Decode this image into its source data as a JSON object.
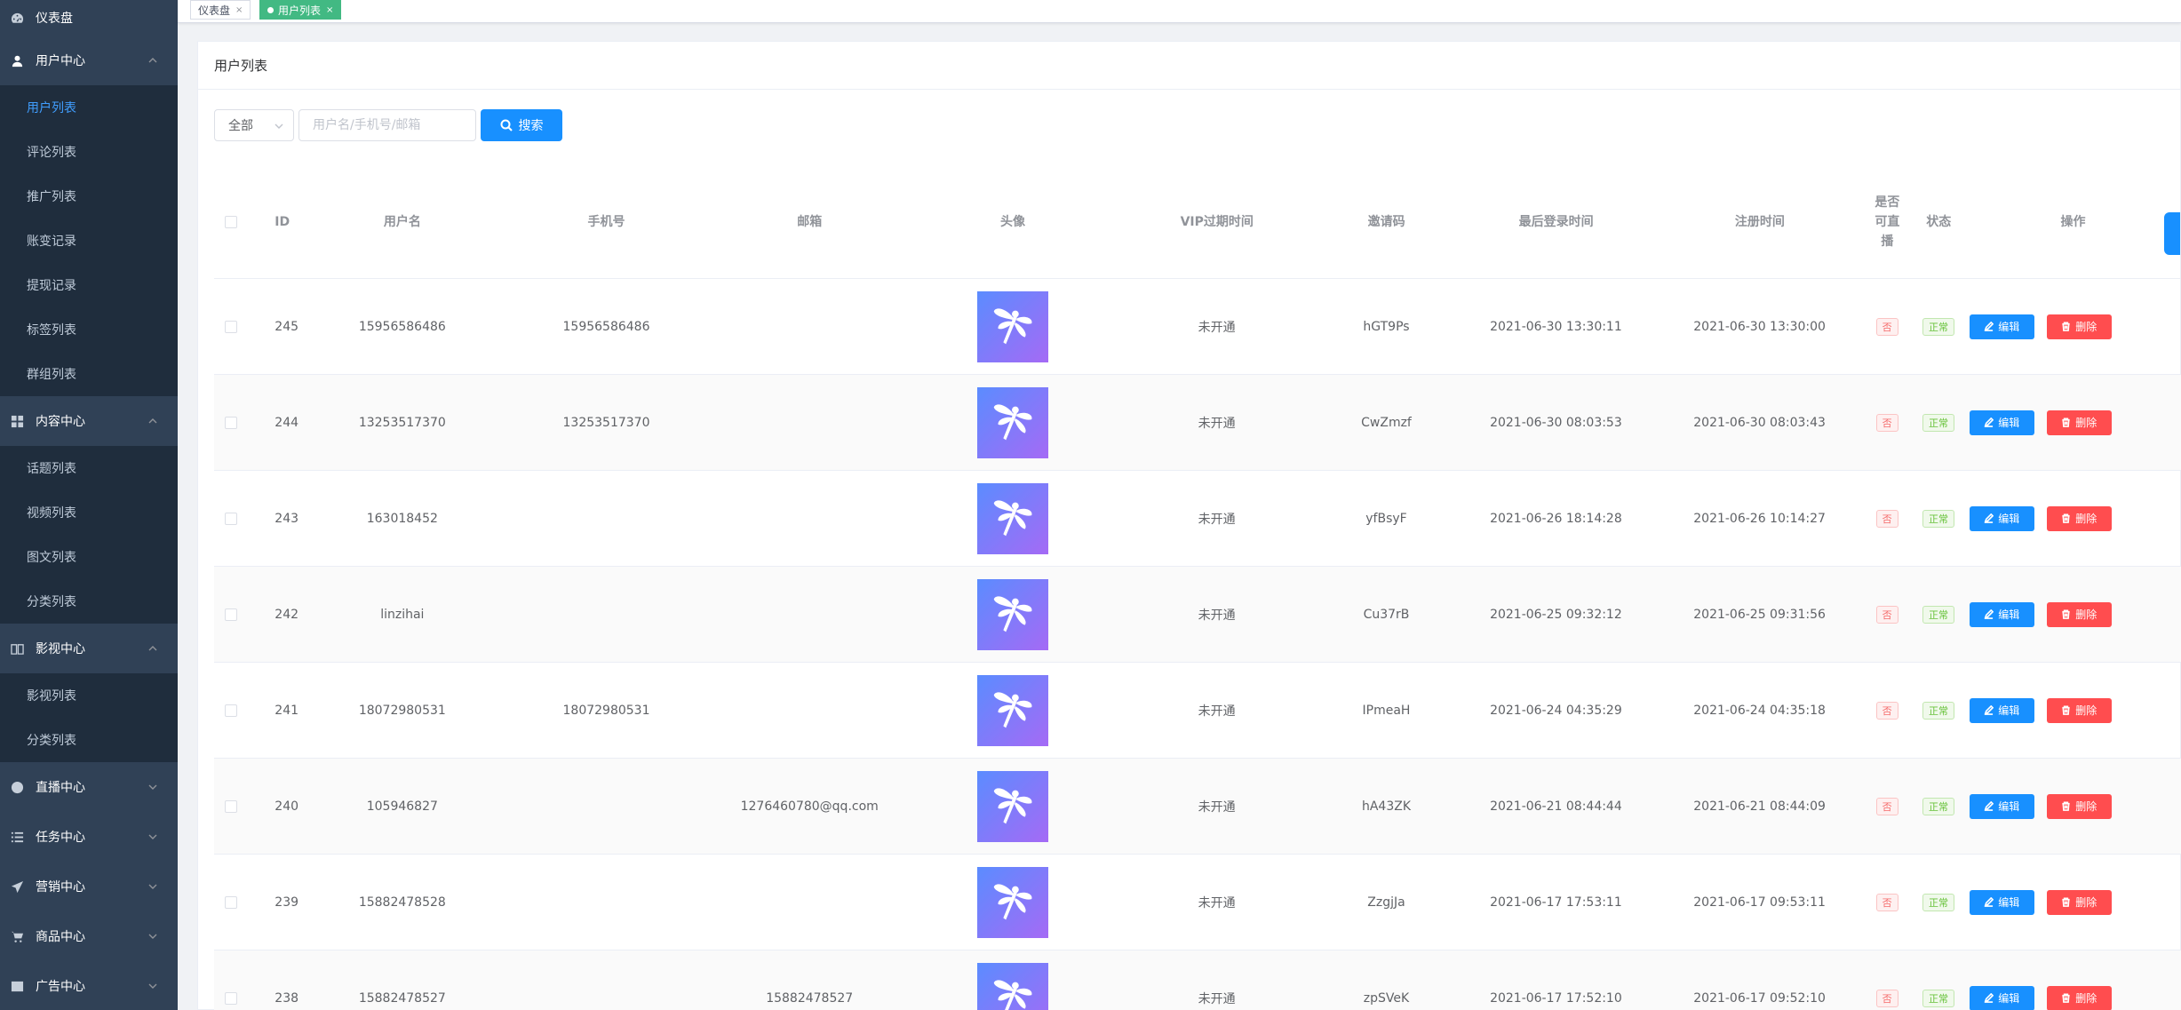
{
  "sidebar": {
    "dashboard": "仪表盘",
    "user_center": "用户中心",
    "user_items": [
      "用户列表",
      "评论列表",
      "推广列表",
      "账变记录",
      "提现记录",
      "标签列表",
      "群组列表"
    ],
    "content_center": "内容中心",
    "content_items": [
      "话题列表",
      "视频列表",
      "图文列表",
      "分类列表"
    ],
    "movie_center": "影视中心",
    "movie_items": [
      "影视列表",
      "分类列表"
    ],
    "live_center": "直播中心",
    "task_center": "任务中心",
    "marketing_center": "营销中心",
    "goods_center": "商品中心",
    "ad_center": "广告中心"
  },
  "tags": {
    "dashboard": "仪表盘",
    "user_list": "用户列表",
    "close": "×"
  },
  "card": {
    "title": "用户列表"
  },
  "filter": {
    "select_value": "全部",
    "search_placeholder": "用户名/手机号/邮箱",
    "search_label": "搜索"
  },
  "table": {
    "headers": {
      "id": "ID",
      "username": "用户名",
      "phone": "手机号",
      "email": "邮箱",
      "avatar": "头像",
      "vip": "VIP过期时间",
      "invite": "邀请码",
      "last_login": "最后登录时间",
      "register": "注册时间",
      "live_1": "是否",
      "live_2": "可直",
      "live_3": "播",
      "status": "状态",
      "ops": "操作"
    },
    "rows": [
      {
        "id": "245",
        "username": "15956586486",
        "phone": "15956586486",
        "email": "",
        "vip": "未开通",
        "invite": "hGT9Ps",
        "last_login": "2021-06-30 13:30:11",
        "register": "2021-06-30 13:30:00",
        "live": "否",
        "status": "正常"
      },
      {
        "id": "244",
        "username": "13253517370",
        "phone": "13253517370",
        "email": "",
        "vip": "未开通",
        "invite": "CwZmzf",
        "last_login": "2021-06-30 08:03:53",
        "register": "2021-06-30 08:03:43",
        "live": "否",
        "status": "正常"
      },
      {
        "id": "243",
        "username": "163018452",
        "phone": "",
        "email": "",
        "vip": "未开通",
        "invite": "yfBsyF",
        "last_login": "2021-06-26 18:14:28",
        "register": "2021-06-26 10:14:27",
        "live": "否",
        "status": "正常"
      },
      {
        "id": "242",
        "username": "linzihai",
        "phone": "",
        "email": "",
        "vip": "未开通",
        "invite": "Cu37rB",
        "last_login": "2021-06-25 09:32:12",
        "register": "2021-06-25 09:31:56",
        "live": "否",
        "status": "正常"
      },
      {
        "id": "241",
        "username": "18072980531",
        "phone": "18072980531",
        "email": "",
        "vip": "未开通",
        "invite": "IPmeaH",
        "last_login": "2021-06-24 04:35:29",
        "register": "2021-06-24 04:35:18",
        "live": "否",
        "status": "正常"
      },
      {
        "id": "240",
        "username": "105946827",
        "phone": "",
        "email": "1276460780@qq.com",
        "vip": "未开通",
        "invite": "hA43ZK",
        "last_login": "2021-06-21 08:44:44",
        "register": "2021-06-21 08:44:09",
        "live": "否",
        "status": "正常"
      },
      {
        "id": "239",
        "username": "15882478528",
        "phone": "",
        "email": "",
        "vip": "未开通",
        "invite": "ZzgjJa",
        "last_login": "2021-06-17 17:53:11",
        "register": "2021-06-17 09:53:11",
        "live": "否",
        "status": "正常"
      },
      {
        "id": "238",
        "username": "15882478527",
        "phone": "",
        "email": "15882478527",
        "vip": "未开通",
        "invite": "zpSVeK",
        "last_login": "2021-06-17 17:52:10",
        "register": "2021-06-17 09:52:10",
        "live": "否",
        "status": "正常"
      }
    ],
    "edit_label": "编辑",
    "delete_label": "删除"
  }
}
